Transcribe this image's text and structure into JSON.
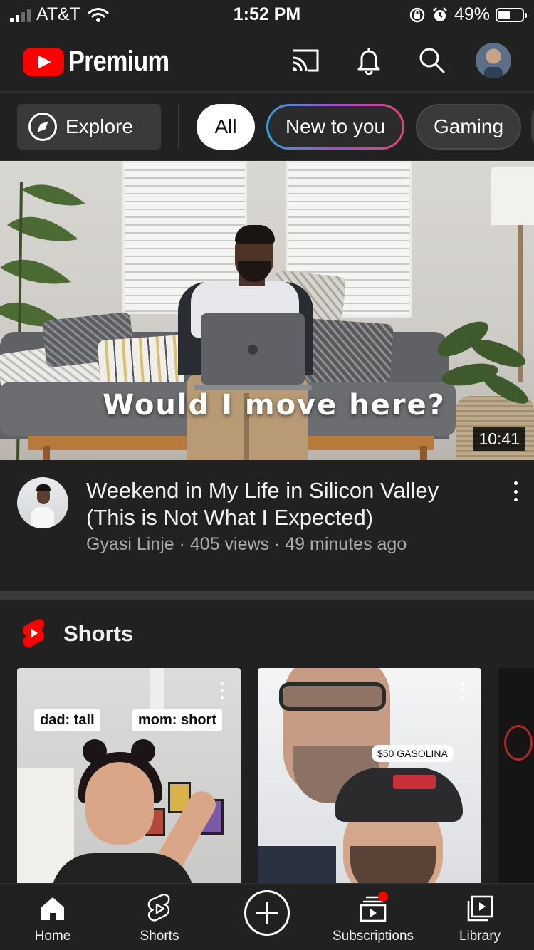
{
  "status_bar": {
    "carrier": "AT&T",
    "time": "1:52 PM",
    "battery_percent": "49%",
    "battery_level": 0.49,
    "signal_bars": 2
  },
  "header": {
    "brand": "Premium",
    "icons": [
      "cast-icon",
      "bell-icon",
      "search-icon",
      "avatar"
    ]
  },
  "chips": {
    "explore": "Explore",
    "items": [
      "All",
      "New to you",
      "Gaming"
    ],
    "selected": "All"
  },
  "featured_video": {
    "thumbnail_caption": "Would I move here?",
    "duration": "10:41",
    "title": "Weekend in My Life in Silicon Valley (This is Not What I Expected)",
    "channel": "Gyasi Linje",
    "views": "405 views",
    "age": "49 minutes ago",
    "subtitle": "Gyasi Linje · 405 views · 49 minutes ago"
  },
  "shorts": {
    "title": "Shorts",
    "cards": [
      {
        "labels": [
          "dad: tall",
          "mom: short"
        ]
      },
      {
        "labels": [
          "$50 GASOLINA"
        ]
      },
      {
        "labels": []
      }
    ]
  },
  "bottom_nav": {
    "items": [
      "Home",
      "Shorts",
      "Create",
      "Subscriptions",
      "Library"
    ]
  },
  "colors": {
    "background": "#212121",
    "brand_red": "#ff0000",
    "text_primary": "#f1f1f1",
    "text_secondary": "#aaaaaa"
  }
}
